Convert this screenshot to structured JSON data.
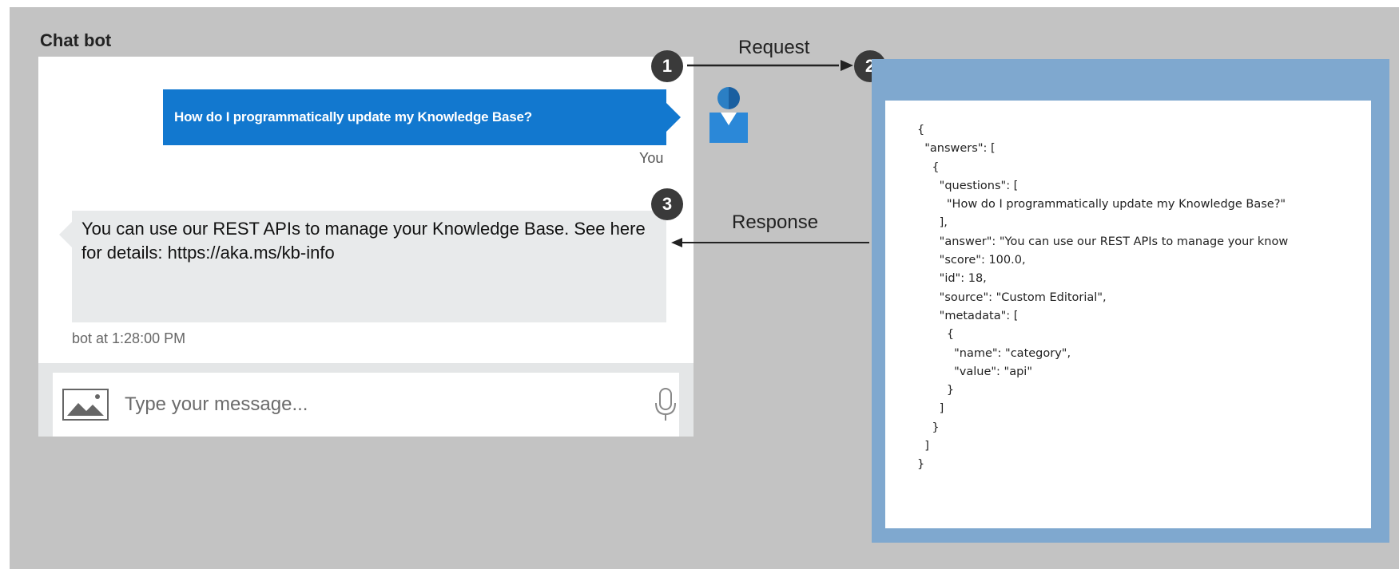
{
  "panel_title": "Chat bot",
  "steps": [
    "1",
    "2",
    "3"
  ],
  "arrows": {
    "request_label": "Request",
    "response_label": "Response"
  },
  "chat": {
    "user_message": "How do I programmatically update my Knowledge Base?",
    "user_caption": "You",
    "bot_message": "You can use our REST APIs to manage your Knowledge Base. See here for details: https://aka.ms/kb-info",
    "bot_caption": "bot at 1:28:00 PM",
    "input_placeholder": "Type your message..."
  },
  "icons": {
    "avatar": "user-avatar-icon",
    "image": "image-upload-icon",
    "mic": "microphone-icon"
  },
  "colors": {
    "user_bubble": "#1278cf",
    "api_frame": "#7fa8cf",
    "bot_bubble": "#e8eaeb",
    "step_badge": "#3a3a3a"
  },
  "json_lines": [
    "{",
    "  \"answers\": [",
    "    {",
    "      \"questions\": [",
    "        \"How do I programmatically update my Knowledge Base?\"",
    "      ],",
    "      \"answer\": \"You can use our REST APIs to manage your know",
    "      \"score\": 100.0,",
    "      \"id\": 18,",
    "      \"source\": \"Custom Editorial\",",
    "      \"metadata\": [",
    "        {",
    "          \"name\": \"category\",",
    "          \"value\": \"api\"",
    "        }",
    "      ]",
    "    }",
    "  ]",
    "}"
  ]
}
